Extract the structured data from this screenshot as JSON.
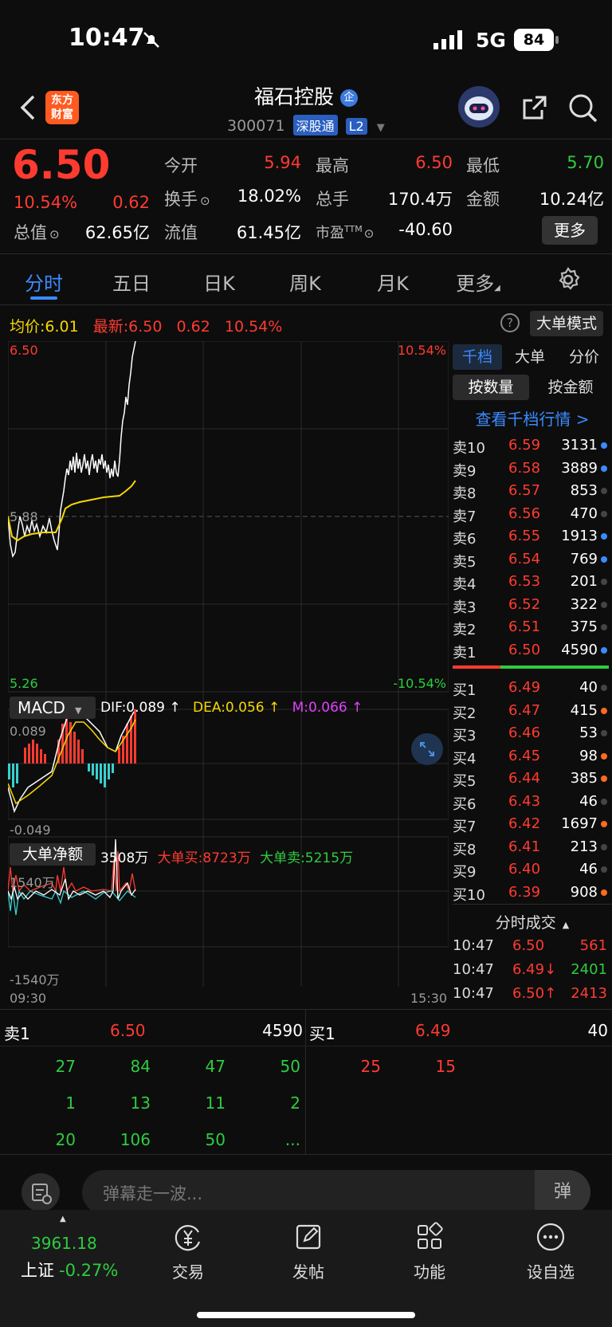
{
  "status": {
    "time": "10:47",
    "network": "5G",
    "battery": "84"
  },
  "header": {
    "logo_line1": "东方",
    "logo_line2": "财富",
    "name": "福石控股",
    "name_badge": "企",
    "code": "300071",
    "market_tag": "深股通",
    "level_tag": "L2"
  },
  "quote": {
    "price": "6.50",
    "change_pct": "10.54%",
    "change": "0.62",
    "open_label": "今开",
    "open": "5.94",
    "high_label": "最高",
    "high": "6.50",
    "low_label": "最低",
    "low": "5.70",
    "turnover_label": "换手",
    "turnover": "18.02%",
    "volume_label": "总手",
    "volume": "170.4万",
    "amount_label": "金额",
    "amount": "10.24亿",
    "mktcap_label": "总值",
    "mktcap": "62.65亿",
    "float_label": "流值",
    "float": "61.45亿",
    "pe_label": "市盈",
    "pe_sup": "TTM",
    "pe": "-40.60",
    "more": "更多"
  },
  "tabs": [
    "分时",
    "五日",
    "日K",
    "周K",
    "月K",
    "更多"
  ],
  "intraday": {
    "avg_label": "均价:",
    "avg": "6.01",
    "latest_label": "最新:",
    "latest": "6.50",
    "chg": "0.62",
    "pct": "10.54%",
    "mode_btn": "大单模式",
    "y_top": "6.50",
    "y_bot": "5.26",
    "pct_top": "10.54%",
    "pct_bot": "-10.54%",
    "mid": "5.88",
    "t_start": "09:30",
    "t_end": "15:30"
  },
  "macd": {
    "name": "MACD",
    "dif": "DIF:0.089 ↑",
    "dea": "DEA:0.056 ↑",
    "m": "M:0.066 ↑",
    "top": "0.089",
    "bot": "-0.049"
  },
  "bigorder": {
    "name": "大单净额",
    "net": "3508万",
    "buy": "大单买:8723万",
    "sell": "大单卖:5215万",
    "top": "1540万",
    "bot": "-1540万"
  },
  "orderbook": {
    "tabs": [
      "千档",
      "大单",
      "分价"
    ],
    "sub_tabs": [
      "按数量",
      "按金额"
    ],
    "link": "查看千档行情 >",
    "asks": [
      {
        "l": "卖10",
        "p": "6.59",
        "v": "3131"
      },
      {
        "l": "卖9",
        "p": "6.58",
        "v": "3889"
      },
      {
        "l": "卖8",
        "p": "6.57",
        "v": "853"
      },
      {
        "l": "卖7",
        "p": "6.56",
        "v": "470"
      },
      {
        "l": "卖6",
        "p": "6.55",
        "v": "1913"
      },
      {
        "l": "卖5",
        "p": "6.54",
        "v": "769"
      },
      {
        "l": "卖4",
        "p": "6.53",
        "v": "201"
      },
      {
        "l": "卖3",
        "p": "6.52",
        "v": "322"
      },
      {
        "l": "卖2",
        "p": "6.51",
        "v": "375"
      },
      {
        "l": "卖1",
        "p": "6.50",
        "v": "4590"
      }
    ],
    "bids": [
      {
        "l": "买1",
        "p": "6.49",
        "v": "40"
      },
      {
        "l": "买2",
        "p": "6.47",
        "v": "415"
      },
      {
        "l": "买3",
        "p": "6.46",
        "v": "53"
      },
      {
        "l": "买4",
        "p": "6.45",
        "v": "98"
      },
      {
        "l": "买5",
        "p": "6.44",
        "v": "385"
      },
      {
        "l": "买6",
        "p": "6.43",
        "v": "46"
      },
      {
        "l": "买7",
        "p": "6.42",
        "v": "1697"
      },
      {
        "l": "买8",
        "p": "6.41",
        "v": "213"
      },
      {
        "l": "买9",
        "p": "6.40",
        "v": "46"
      },
      {
        "l": "买10",
        "p": "6.39",
        "v": "908"
      }
    ],
    "ticks_title": "分时成交",
    "ticks": [
      {
        "t": "10:47",
        "p": "6.50",
        "v": "561"
      },
      {
        "t": "10:47",
        "p": "6.49↓",
        "v": "2401"
      },
      {
        "t": "10:47",
        "p": "6.50↑",
        "v": "2413"
      }
    ]
  },
  "queue": {
    "ask_label": "卖1",
    "ask_price": "6.50",
    "ask_vol": "4590",
    "bid_label": "买1",
    "bid_price": "6.49",
    "bid_vol": "40",
    "ask_rows": [
      [
        "27",
        "84",
        "47",
        "50"
      ],
      [
        "1",
        "13",
        "11",
        "2"
      ],
      [
        "20",
        "106",
        "50",
        "..."
      ]
    ],
    "bid_rows": [
      [
        "25",
        "15"
      ]
    ]
  },
  "danmu": {
    "placeholder": "弹幕走一波...",
    "btn": "弹"
  },
  "bottom": {
    "index_value": "3961.18",
    "index_name": "上证",
    "index_chg": "-0.27%",
    "items": [
      "交易",
      "发帖",
      "功能",
      "设自选"
    ]
  }
}
